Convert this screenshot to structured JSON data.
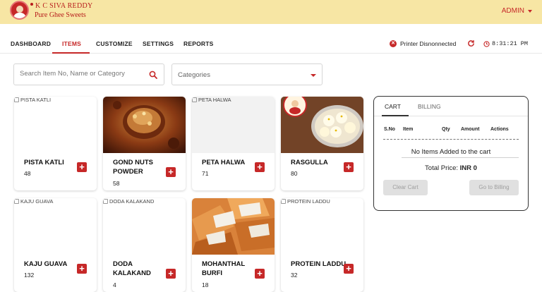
{
  "header": {
    "brand_name": "K C SIVA REDDY",
    "brand_tagline": "Pure Ghee Sweets",
    "user_menu": "ADMIN"
  },
  "nav": {
    "tabs": [
      {
        "label": "DASHBOARD"
      },
      {
        "label": "ITEMS",
        "active": true
      },
      {
        "label": "CUSTOMIZE"
      },
      {
        "label": "SETTINGS"
      },
      {
        "label": "REPORTS"
      }
    ],
    "printer_status": "Printer Disnonnected",
    "time": "8:31:21 PM"
  },
  "filters": {
    "search_placeholder": "Search Item No, Name or Category",
    "category_placeholder": "Categories"
  },
  "items": [
    {
      "name": "PISTA KATLI",
      "price": "48",
      "image_alt": "PISTA KATLI",
      "image": "broken"
    },
    {
      "name": "GOND NUTS POWDER",
      "price": "58",
      "image_alt": "",
      "image": "gond-nuts"
    },
    {
      "name": "PETA HALWA",
      "price": "71",
      "image_alt": "PETA HALWA",
      "image": "broken"
    },
    {
      "name": "RASGULLA",
      "price": "80",
      "image_alt": "",
      "image": "rasgulla"
    },
    {
      "name": "KAJU GUAVA",
      "price": "132",
      "image_alt": "KAJU GUAVA",
      "image": "broken"
    },
    {
      "name": "DODA KALAKAND",
      "price": "4",
      "image_alt": "DODA KALAKAND",
      "image": "broken"
    },
    {
      "name": "MOHANTHAL BURFI",
      "price": "18",
      "image_alt": "",
      "image": "mohanthal"
    },
    {
      "name": "PROTEIN LADDU",
      "price": "32",
      "image_alt": "PROTEIN LADDU",
      "image": "broken"
    }
  ],
  "cart": {
    "tabs": [
      "CART",
      "BILLING"
    ],
    "columns": [
      "S.No",
      "Item",
      "Qty",
      "Amount",
      "Actions"
    ],
    "empty_message": "No Items Added to the cart",
    "total_label": "Total Price:",
    "total_value": "INR 0",
    "clear_button": "Clear Cart",
    "billing_button": "Go to Billing"
  },
  "colors": {
    "accent": "#c62828",
    "header_bg": "#f7e6a4"
  }
}
